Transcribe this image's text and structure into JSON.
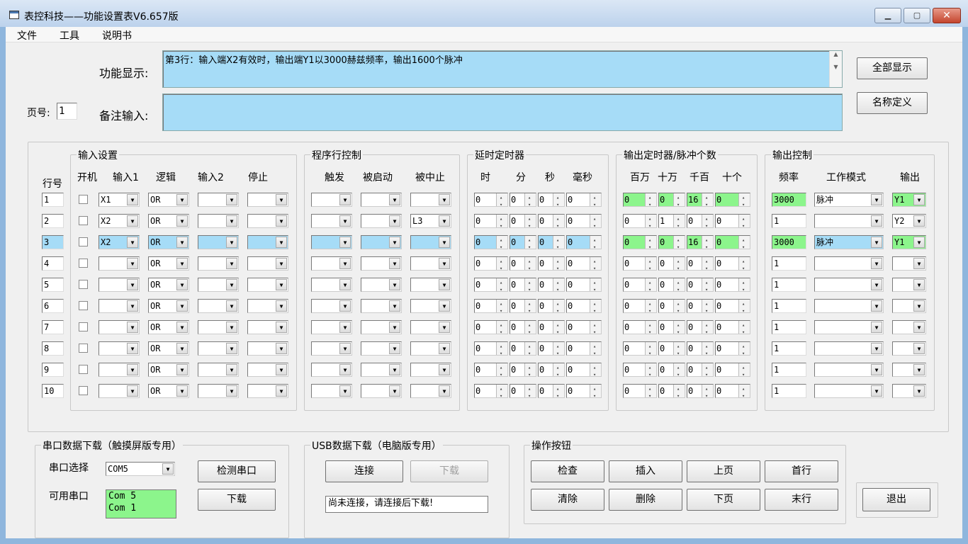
{
  "window": {
    "title": "表控科技——功能设置表V6.657版",
    "minimize": "▁",
    "maximize": "▢",
    "close": "✕"
  },
  "menu": [
    "文件",
    "工具",
    "说明书"
  ],
  "function_display": {
    "label": "功能显示:",
    "value": "第3行：输入端X2有效时，输出端Y1以3000赫兹频率，输出1600个脉冲"
  },
  "note_input": {
    "label": "备注输入:",
    "value": ""
  },
  "page": {
    "label": "页号:",
    "value": "1"
  },
  "buttons": {
    "show_all": "全部显示",
    "name_define": "名称定义",
    "exit": "退出"
  },
  "groups": {
    "input_settings": "输入设置",
    "program_line_control": "程序行控制",
    "delay_timer": "延时定时器",
    "output_timer": "输出定时器/脉冲个数",
    "output_control": "输出控制"
  },
  "headers": {
    "row_no": "行号",
    "power_on": "开机",
    "input1": "输入1",
    "logic": "逻辑",
    "input2": "输入2",
    "stop": "停止",
    "trigger": "触发",
    "started": "被启动",
    "aborted": "被中止",
    "hour": "时",
    "minute": "分",
    "second": "秒",
    "millisecond": "毫秒",
    "million": "百万",
    "hundred_thousand": "十万",
    "thousand_hundred": "千百",
    "ten_unit": "十个",
    "frequency": "频率",
    "mode": "工作模式",
    "output": "输出"
  },
  "rows": [
    {
      "no": "1",
      "in1": "X1",
      "logic": "OR",
      "in2": "",
      "stop": "",
      "trigger": "",
      "started": "",
      "aborted": "",
      "delay": [
        "0",
        "0",
        "0",
        "0"
      ],
      "out_timer": [
        "0",
        "0",
        "16",
        "0"
      ],
      "freq": "3000",
      "mode": "脉冲",
      "output": "Y1",
      "out_green": true,
      "selected": false
    },
    {
      "no": "2",
      "in1": "X2",
      "logic": "OR",
      "in2": "",
      "stop": "",
      "trigger": "",
      "started": "",
      "aborted": "L3",
      "delay": [
        "0",
        "0",
        "0",
        "0"
      ],
      "out_timer": [
        "0",
        "1",
        "0",
        "0"
      ],
      "freq": "1",
      "mode": "",
      "output": "Y2",
      "out_green": false,
      "selected": false
    },
    {
      "no": "3",
      "in1": "X2",
      "logic": "OR",
      "in2": "",
      "stop": "",
      "trigger": "",
      "started": "",
      "aborted": "",
      "delay": [
        "0",
        "0",
        "0",
        "0"
      ],
      "out_timer": [
        "0",
        "0",
        "16",
        "0"
      ],
      "freq": "3000",
      "mode": "脉冲",
      "output": "Y1",
      "out_green": true,
      "selected": true
    },
    {
      "no": "4",
      "in1": "",
      "logic": "OR",
      "in2": "",
      "stop": "",
      "trigger": "",
      "started": "",
      "aborted": "",
      "delay": [
        "0",
        "0",
        "0",
        "0"
      ],
      "out_timer": [
        "0",
        "0",
        "0",
        "0"
      ],
      "freq": "1",
      "mode": "",
      "output": "",
      "out_green": false,
      "selected": false
    },
    {
      "no": "5",
      "in1": "",
      "logic": "OR",
      "in2": "",
      "stop": "",
      "trigger": "",
      "started": "",
      "aborted": "",
      "delay": [
        "0",
        "0",
        "0",
        "0"
      ],
      "out_timer": [
        "0",
        "0",
        "0",
        "0"
      ],
      "freq": "1",
      "mode": "",
      "output": "",
      "out_green": false,
      "selected": false
    },
    {
      "no": "6",
      "in1": "",
      "logic": "OR",
      "in2": "",
      "stop": "",
      "trigger": "",
      "started": "",
      "aborted": "",
      "delay": [
        "0",
        "0",
        "0",
        "0"
      ],
      "out_timer": [
        "0",
        "0",
        "0",
        "0"
      ],
      "freq": "1",
      "mode": "",
      "output": "",
      "out_green": false,
      "selected": false
    },
    {
      "no": "7",
      "in1": "",
      "logic": "OR",
      "in2": "",
      "stop": "",
      "trigger": "",
      "started": "",
      "aborted": "",
      "delay": [
        "0",
        "0",
        "0",
        "0"
      ],
      "out_timer": [
        "0",
        "0",
        "0",
        "0"
      ],
      "freq": "1",
      "mode": "",
      "output": "",
      "out_green": false,
      "selected": false
    },
    {
      "no": "8",
      "in1": "",
      "logic": "OR",
      "in2": "",
      "stop": "",
      "trigger": "",
      "started": "",
      "aborted": "",
      "delay": [
        "0",
        "0",
        "0",
        "0"
      ],
      "out_timer": [
        "0",
        "0",
        "0",
        "0"
      ],
      "freq": "1",
      "mode": "",
      "output": "",
      "out_green": false,
      "selected": false
    },
    {
      "no": "9",
      "in1": "",
      "logic": "OR",
      "in2": "",
      "stop": "",
      "trigger": "",
      "started": "",
      "aborted": "",
      "delay": [
        "0",
        "0",
        "0",
        "0"
      ],
      "out_timer": [
        "0",
        "0",
        "0",
        "0"
      ],
      "freq": "1",
      "mode": "",
      "output": "",
      "out_green": false,
      "selected": false
    },
    {
      "no": "10",
      "in1": "",
      "logic": "OR",
      "in2": "",
      "stop": "",
      "trigger": "",
      "started": "",
      "aborted": "",
      "delay": [
        "0",
        "0",
        "0",
        "0"
      ],
      "out_timer": [
        "0",
        "0",
        "0",
        "0"
      ],
      "freq": "1",
      "mode": "",
      "output": "",
      "out_green": false,
      "selected": false
    }
  ],
  "serial": {
    "group": "串口数据下载（触摸屏版专用）",
    "select_label": "串口选择",
    "select_value": "COM5",
    "available_label": "可用串口",
    "available_ports": [
      "Com 5",
      "Com 1"
    ],
    "detect_button": "检测串口",
    "download_button": "下载"
  },
  "usb": {
    "group": "USB数据下载（电脑版专用）",
    "connect_button": "连接",
    "download_button": "下载",
    "status": "尚未连接，请连接后下载!"
  },
  "ops": {
    "group": "操作按钮",
    "check": "检查",
    "insert": "插入",
    "prev_page": "上页",
    "first_row": "首行",
    "clear": "清除",
    "delete": "删除",
    "next_page": "下页",
    "last_row": "末行"
  },
  "colors": {
    "field_blue": "#a6dcf7",
    "field_green": "#8cf58c",
    "window_bg": "#f0f0f0"
  }
}
